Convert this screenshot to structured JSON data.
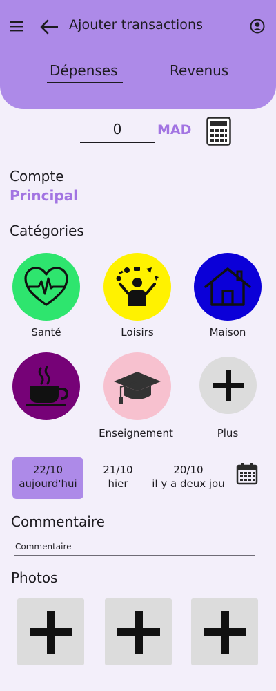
{
  "header": {
    "title": "Ajouter transactions",
    "icons": {
      "menu": "menu-icon",
      "back": "arrow-left-icon",
      "account": "account-circle-icon"
    },
    "tabs": [
      {
        "label": "Dépenses",
        "selected": true
      },
      {
        "label": "Revenus",
        "selected": false
      }
    ],
    "color": "#ad8ae8"
  },
  "amount": {
    "value": "0",
    "currency": "MAD",
    "calculator_icon": "calculator-icon"
  },
  "account": {
    "label": "Compte",
    "value": "Principal"
  },
  "categories": {
    "label": "Catégories",
    "items": [
      {
        "name": "Santé",
        "icon": "heart-pulse-icon",
        "color": "#2ee56e"
      },
      {
        "name": "Loisirs",
        "icon": "juggler-icon",
        "color": "#fff200"
      },
      {
        "name": "Maison",
        "icon": "house-icon",
        "color": "#0b00d8"
      },
      {
        "name": "",
        "icon": "coffee-cup-icon",
        "color": "#760277"
      },
      {
        "name": "Enseignement",
        "icon": "graduation-cap-icon",
        "color": "#f7c1cf"
      },
      {
        "name": "Plus",
        "icon": "plus-icon",
        "color": "#dcdcdc"
      }
    ]
  },
  "dates": {
    "items": [
      {
        "date": "22/10",
        "caption": "aujourd'hui",
        "selected": true
      },
      {
        "date": "21/10",
        "caption": "hier",
        "selected": false
      },
      {
        "date": "20/10",
        "caption": "il y a deux jou",
        "selected": false
      }
    ],
    "calendar_icon": "calendar-icon"
  },
  "comment": {
    "label": "Commentaire",
    "placeholder": "Commentaire"
  },
  "photos": {
    "label": "Photos",
    "slots": [
      "plus-icon",
      "plus-icon",
      "plus-icon"
    ]
  },
  "accent": "#a274e2"
}
